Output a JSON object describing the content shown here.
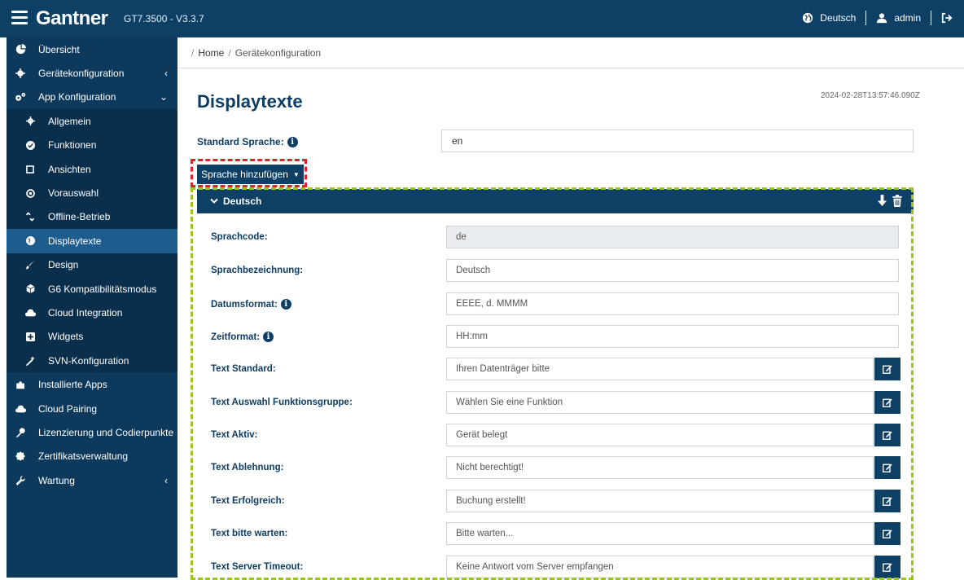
{
  "header": {
    "logo": "Gantner",
    "version": "GT7.3500 - V3.3.7",
    "language": "Deutsch",
    "user": "admin"
  },
  "sidebar": {
    "items": [
      {
        "label": "Übersicht",
        "icon": "pie-chart-icon"
      },
      {
        "label": "Gerätekonfiguration",
        "icon": "gear-icon",
        "caret": "‹"
      },
      {
        "label": "App Konfiguration",
        "icon": "gears-icon",
        "caret": "⌄"
      },
      {
        "label": "Allgemein",
        "icon": "gear-icon"
      },
      {
        "label": "Funktionen",
        "icon": "check-circle-icon"
      },
      {
        "label": "Ansichten",
        "icon": "square-icon"
      },
      {
        "label": "Vorauswahl",
        "icon": "circle-dot-icon"
      },
      {
        "label": "Offline-Betrieb",
        "icon": "unlink-icon"
      },
      {
        "label": "Displaytexte",
        "icon": "globe-icon"
      },
      {
        "label": "Design",
        "icon": "brush-icon"
      },
      {
        "label": "G6 Kompatibilitätsmodus",
        "icon": "cube-icon"
      },
      {
        "label": "Cloud Integration",
        "icon": "cloud-icon"
      },
      {
        "label": "Widgets",
        "icon": "plus-square-icon"
      },
      {
        "label": "SVN-Konfiguration",
        "icon": "magic-icon"
      },
      {
        "label": "Installierte Apps",
        "icon": "puzzle-icon"
      },
      {
        "label": "Cloud Pairing",
        "icon": "cloud-icon"
      },
      {
        "label": "Lizenzierung und Codierpunkte",
        "icon": "key-icon"
      },
      {
        "label": "Zertifikatsverwaltung",
        "icon": "certificate-icon"
      },
      {
        "label": "Wartung",
        "icon": "wrench-icon",
        "caret": "‹"
      }
    ]
  },
  "breadcrumb": {
    "home": "Home",
    "current": "Gerätekonfiguration"
  },
  "page": {
    "title": "Displaytexte",
    "timestamp": "2024-02-28T13:57:46.090Z",
    "standard_label": "Standard Sprache:",
    "standard_value": "en",
    "add_language": "Sprache hinzufügen"
  },
  "panel": {
    "title": "Deutsch",
    "fields": [
      {
        "label": "Sprachcode:",
        "value": "de"
      },
      {
        "label": "Sprachbezeichnung:",
        "value": "Deutsch"
      },
      {
        "label": "Datumsformat:",
        "value": "EEEE, d. MMMM"
      },
      {
        "label": "Zeitformat:",
        "value": "HH:mm"
      },
      {
        "label": "Text Standard:",
        "value": "Ihren Datenträger bitte"
      },
      {
        "label": "Text Auswahl Funktionsgruppe:",
        "value": "Wählen Sie eine Funktion"
      },
      {
        "label": "Text Aktiv:",
        "value": "Gerät belegt"
      },
      {
        "label": "Text Ablehnung:",
        "value": "Nicht berechtigt!"
      },
      {
        "label": "Text Erfolgreich:",
        "value": "Buchung erstellt!"
      },
      {
        "label": "Text bitte warten:",
        "value": "Bitte warten..."
      },
      {
        "label": "Text Server Timeout:",
        "value": "Keine Antwort vom Server empfangen"
      }
    ]
  }
}
